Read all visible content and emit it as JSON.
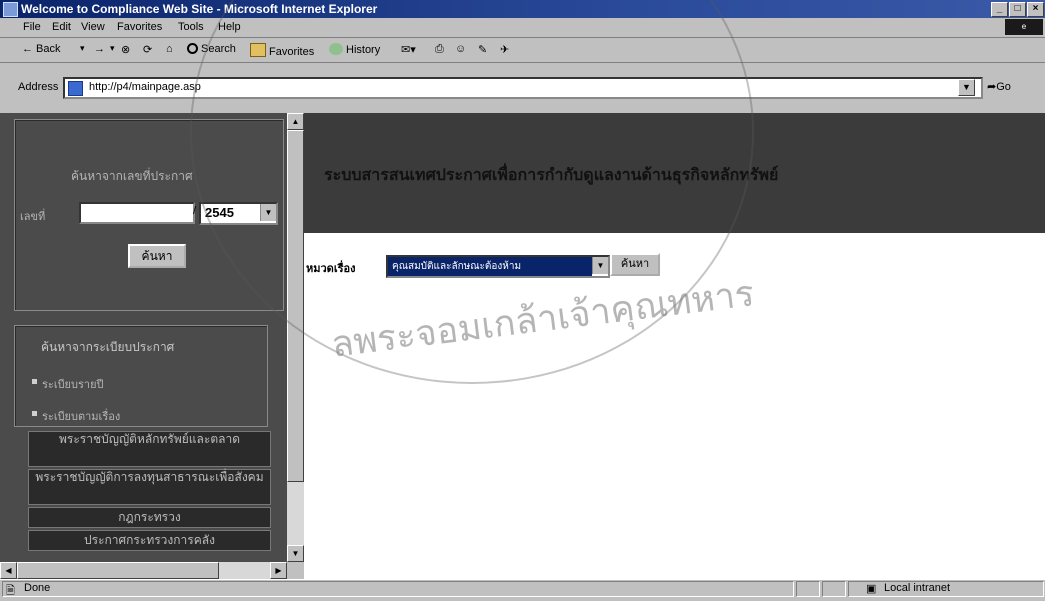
{
  "window": {
    "title": "Welcome to Compliance Web Site - Microsoft Internet Explorer",
    "buttons": [
      "_",
      "□",
      "×"
    ]
  },
  "menu": [
    "File",
    "Edit",
    "View",
    "Favorites",
    "Tools",
    "Help"
  ],
  "toolbar": {
    "back": "← Back",
    "forward": "→",
    "search": "Search",
    "favorites": "Favorites",
    "history": "History"
  },
  "address": {
    "label": "Address",
    "url": "http://p4/mainpage.asp",
    "go": "Go"
  },
  "left": {
    "search_by_number_heading": "ค้นหาจากเลขที่ประกาศ",
    "number_label": "เลขที่",
    "number_value": "",
    "slash": "/",
    "year_value": "2545",
    "search_button": "ค้นหา",
    "search_by_category_heading": "ค้นหาจากระเบียบประกาศ",
    "links": [
      "ระเบียบรายปี",
      "ระเบียบตามเรื่อง"
    ],
    "nav_items": [
      "พระราชบัญญัติหลักทรัพย์และตลาด",
      "พระราชบัญญัติการลงทุนสาธารณะเพื่อสังคม",
      "กฎกระทรวง",
      "ประกาศกระทรวงการคลัง"
    ]
  },
  "right": {
    "banner_title": "ระบบสารสนเทศประกาศเพื่อการกำกับดูแลงานด้านธุรกิจหลักทรัพย์",
    "category_label": "หมวดเรื่อง",
    "category_value": "คุณสมบัติและลักษณะต้องห้าม",
    "search_button": "ค้นหา"
  },
  "watermark_text": "ลพระจอมเกล้าเจ้าคุณทหาร",
  "status": {
    "left": "Done",
    "zone": "Local intranet"
  }
}
